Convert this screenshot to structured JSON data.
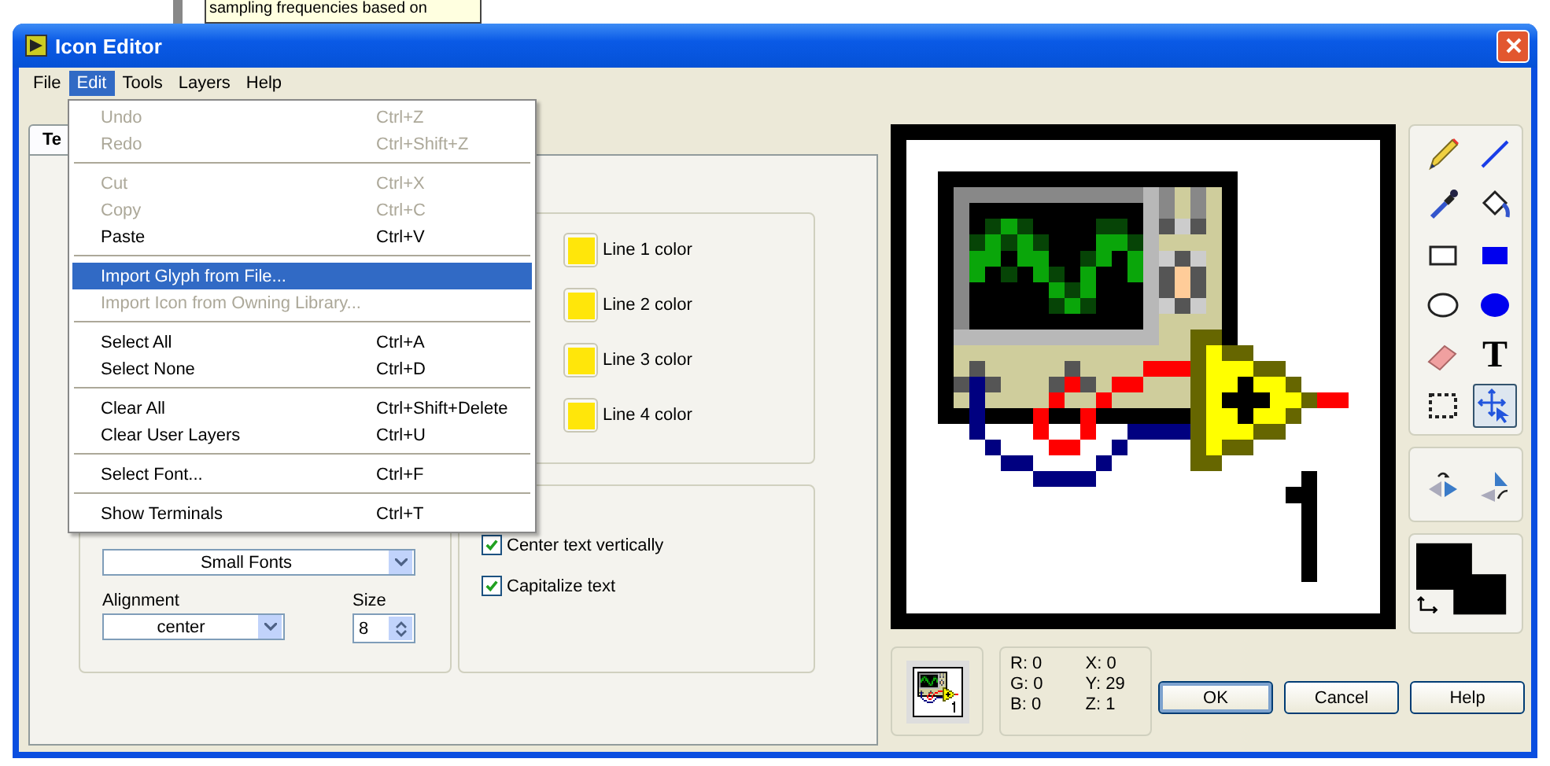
{
  "background": {
    "note_lines": [
      "sampling frequencies based on"
    ]
  },
  "window": {
    "title": "Icon Editor"
  },
  "menu_bar": [
    {
      "label": "File",
      "selected": false
    },
    {
      "label": "Edit",
      "selected": true
    },
    {
      "label": "Tools",
      "selected": false
    },
    {
      "label": "Layers",
      "selected": false
    },
    {
      "label": "Help",
      "selected": false
    }
  ],
  "edit_menu": [
    {
      "kind": "item",
      "label": "Undo",
      "shortcut": "Ctrl+Z",
      "disabled": true,
      "selected": false
    },
    {
      "kind": "item",
      "label": "Redo",
      "shortcut": "Ctrl+Shift+Z",
      "disabled": true,
      "selected": false
    },
    {
      "kind": "separator"
    },
    {
      "kind": "item",
      "label": "Cut",
      "shortcut": "Ctrl+X",
      "disabled": true,
      "selected": false
    },
    {
      "kind": "item",
      "label": "Copy",
      "shortcut": "Ctrl+C",
      "disabled": true,
      "selected": false
    },
    {
      "kind": "item",
      "label": "Paste",
      "shortcut": "Ctrl+V",
      "disabled": false,
      "selected": false
    },
    {
      "kind": "separator"
    },
    {
      "kind": "item",
      "label": "Import Glyph from File...",
      "disabled": false,
      "selected": true
    },
    {
      "kind": "item",
      "label": "Import Icon from Owning Library...",
      "disabled": true,
      "selected": false
    },
    {
      "kind": "separator"
    },
    {
      "kind": "item",
      "label": "Select All",
      "shortcut": "Ctrl+A",
      "disabled": false,
      "selected": false
    },
    {
      "kind": "item",
      "label": "Select None",
      "shortcut": "Ctrl+D",
      "disabled": false,
      "selected": false
    },
    {
      "kind": "separator"
    },
    {
      "kind": "item",
      "label": "Clear All",
      "shortcut": "Ctrl+Shift+Delete",
      "disabled": false,
      "selected": false
    },
    {
      "kind": "item",
      "label": "Clear User Layers",
      "shortcut": "Ctrl+U",
      "disabled": false,
      "selected": false
    },
    {
      "kind": "separator"
    },
    {
      "kind": "item",
      "label": "Select Font...",
      "shortcut": "Ctrl+F",
      "disabled": false,
      "selected": false
    },
    {
      "kind": "separator"
    },
    {
      "kind": "item",
      "label": "Show Terminals",
      "shortcut": "Ctrl+T",
      "disabled": false,
      "selected": false
    }
  ],
  "tabs": [
    {
      "label": "Te",
      "selected": true
    }
  ],
  "font": {
    "value": "Small Fonts"
  },
  "alignment": {
    "label": "Alignment",
    "value": "center"
  },
  "size": {
    "label": "Size",
    "value": "8"
  },
  "line_colors": [
    {
      "label": "Line 1 color",
      "color": "#ffe60a"
    },
    {
      "label": "Line 2 color",
      "color": "#ffe60a"
    },
    {
      "label": "Line 3 color",
      "color": "#ffe60a"
    },
    {
      "label": "Line 4 color",
      "color": "#ffe60a"
    }
  ],
  "options": [
    {
      "label": "Center text vertically",
      "checked": true
    },
    {
      "label": "Capitalize text",
      "checked": true
    }
  ],
  "tools": [
    {
      "kind": "pencil",
      "selected": false
    },
    {
      "kind": "line",
      "selected": false
    },
    {
      "kind": "dropper",
      "selected": false
    },
    {
      "kind": "bucket",
      "selected": false
    },
    {
      "kind": "rect",
      "selected": false
    },
    {
      "kind": "filled-rect",
      "selected": false
    },
    {
      "kind": "ellipse",
      "selected": false
    },
    {
      "kind": "filled-ellipse",
      "selected": false
    },
    {
      "kind": "eraser",
      "selected": false
    },
    {
      "kind": "text",
      "label": "T",
      "selected": false
    },
    {
      "kind": "select",
      "selected": false
    },
    {
      "kind": "move",
      "selected": true
    }
  ],
  "transform_tools": [
    {
      "kind": "flip"
    },
    {
      "kind": "rotate"
    }
  ],
  "info": {
    "left": [
      "R: 0",
      "G: 0",
      "B: 0"
    ],
    "right": [
      "X: 0",
      "Y: 29",
      "Z: 1"
    ]
  },
  "buttons": [
    {
      "label": "OK",
      "default": true
    },
    {
      "label": "Cancel",
      "default": false
    },
    {
      "label": "Help",
      "default": false
    }
  ]
}
